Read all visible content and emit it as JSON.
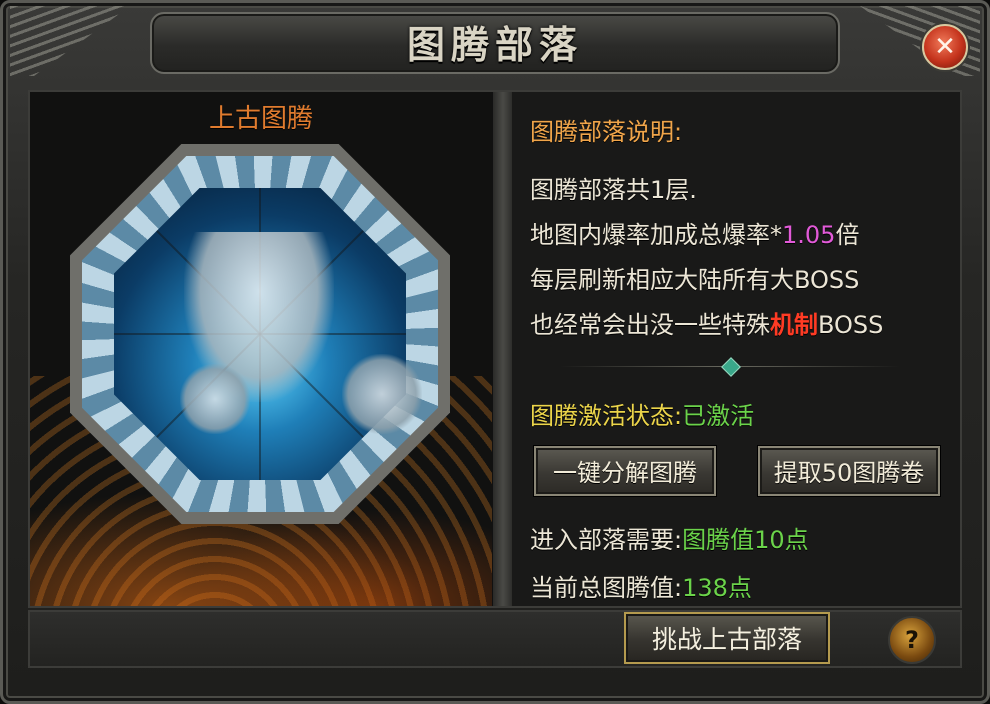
{
  "window": {
    "title": "图腾部落",
    "close_icon": "close-icon"
  },
  "relic": {
    "label": "上古图腾"
  },
  "info": {
    "heading": "图腾部落说明:",
    "lines": [
      "图腾部落共1层.",
      "地图内爆率加成总爆率*",
      "1.05",
      "倍",
      "每层刷新相应大陆所有大BOSS",
      "也经常会出没一些特殊",
      "机制",
      "BOSS"
    ]
  },
  "status": {
    "label": "图腾激活状态:",
    "value": "已激活"
  },
  "buttons": {
    "decompose": "一键分解图腾",
    "extract": "提取50图腾卷",
    "challenge": "挑战上古部落",
    "help": "?"
  },
  "requirement": {
    "label": "进入部落需要:",
    "value": "图腾值10点"
  },
  "total": {
    "label": "当前总图腾值:",
    "value": "138点"
  },
  "colors": {
    "heading": "#f0a54a",
    "highlight_pink": "#e25ad8",
    "highlight_red": "#ff3b24",
    "yellow": "#ecd54a",
    "green": "#6bd34a"
  }
}
